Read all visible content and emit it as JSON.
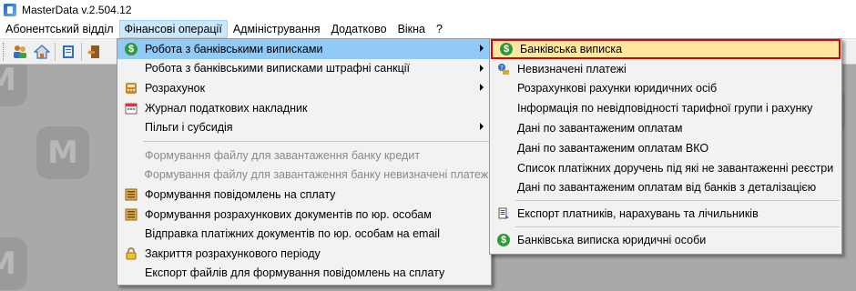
{
  "window": {
    "title": "MasterData v.2.504.12"
  },
  "menubar": {
    "items": [
      {
        "label": "Абонентський відділ"
      },
      {
        "label": "Фінансові операції"
      },
      {
        "label": "Адміністрування"
      },
      {
        "label": "Додатково"
      },
      {
        "label": "Вікна"
      },
      {
        "label": "?"
      }
    ]
  },
  "toolbar": {
    "icons": [
      "users-icon",
      "home-icon",
      "book-icon",
      "exit-door-icon"
    ]
  },
  "dropdown": {
    "items": [
      {
        "label": "Робота з банківськими виписками",
        "icon": "dollar-icon",
        "submenu": true
      },
      {
        "label": "Робота з банківськими виписками штрафні санкції",
        "submenu": true
      },
      {
        "label": "Розрахунок",
        "icon": "calculator-icon",
        "submenu": true
      },
      {
        "label": "Журнал податкових накладник",
        "icon": "calendar-icon"
      },
      {
        "label": "Пільги і субсидія",
        "submenu": true
      },
      {
        "label": "Формування файлу для завантаження банку кредит",
        "disabled": true
      },
      {
        "label": "Формування файлу для завантаження банку невизначені платежі",
        "disabled": true
      },
      {
        "label": "Формування повідомлень на сплату",
        "icon": "list-icon"
      },
      {
        "label": "Формування розрахункових документів по юр. особам",
        "icon": "list-icon"
      },
      {
        "label": "Відправка платіжних документів по юр. особам на email"
      },
      {
        "label": "Закриття розрахункового періоду",
        "icon": "lock-icon"
      },
      {
        "label": "Експорт файлів для формування повідомлень на сплату"
      }
    ]
  },
  "submenu": {
    "items": [
      {
        "label": "Банківська виписка",
        "icon": "dollar-icon"
      },
      {
        "label": "Невизначені платежі",
        "icon": "question-coin-icon"
      },
      {
        "label": "Розрахункові рахунки юридичних осіб"
      },
      {
        "label": "Інформація по невідповідності тарифної групи і рахунку"
      },
      {
        "label": "Дані по завантаженим оплатам"
      },
      {
        "label": "Дані по завантаженим оплатам ВКО"
      },
      {
        "label": "Список платіжних доручень під які не завантаженні реєстри"
      },
      {
        "label": "Дані по завантаженим оплатам від банків з деталізацією"
      },
      {
        "label": "Експорт платників, нарахувань та лічильників",
        "icon": "export-doc-icon"
      },
      {
        "label": "Банківська виписка юридичні особи",
        "icon": "dollar-icon"
      }
    ]
  },
  "colors": {
    "menu_highlight": "#91c9f7",
    "submenu_highlight": "#ffe7a0",
    "highlight_border": "#e00000"
  }
}
